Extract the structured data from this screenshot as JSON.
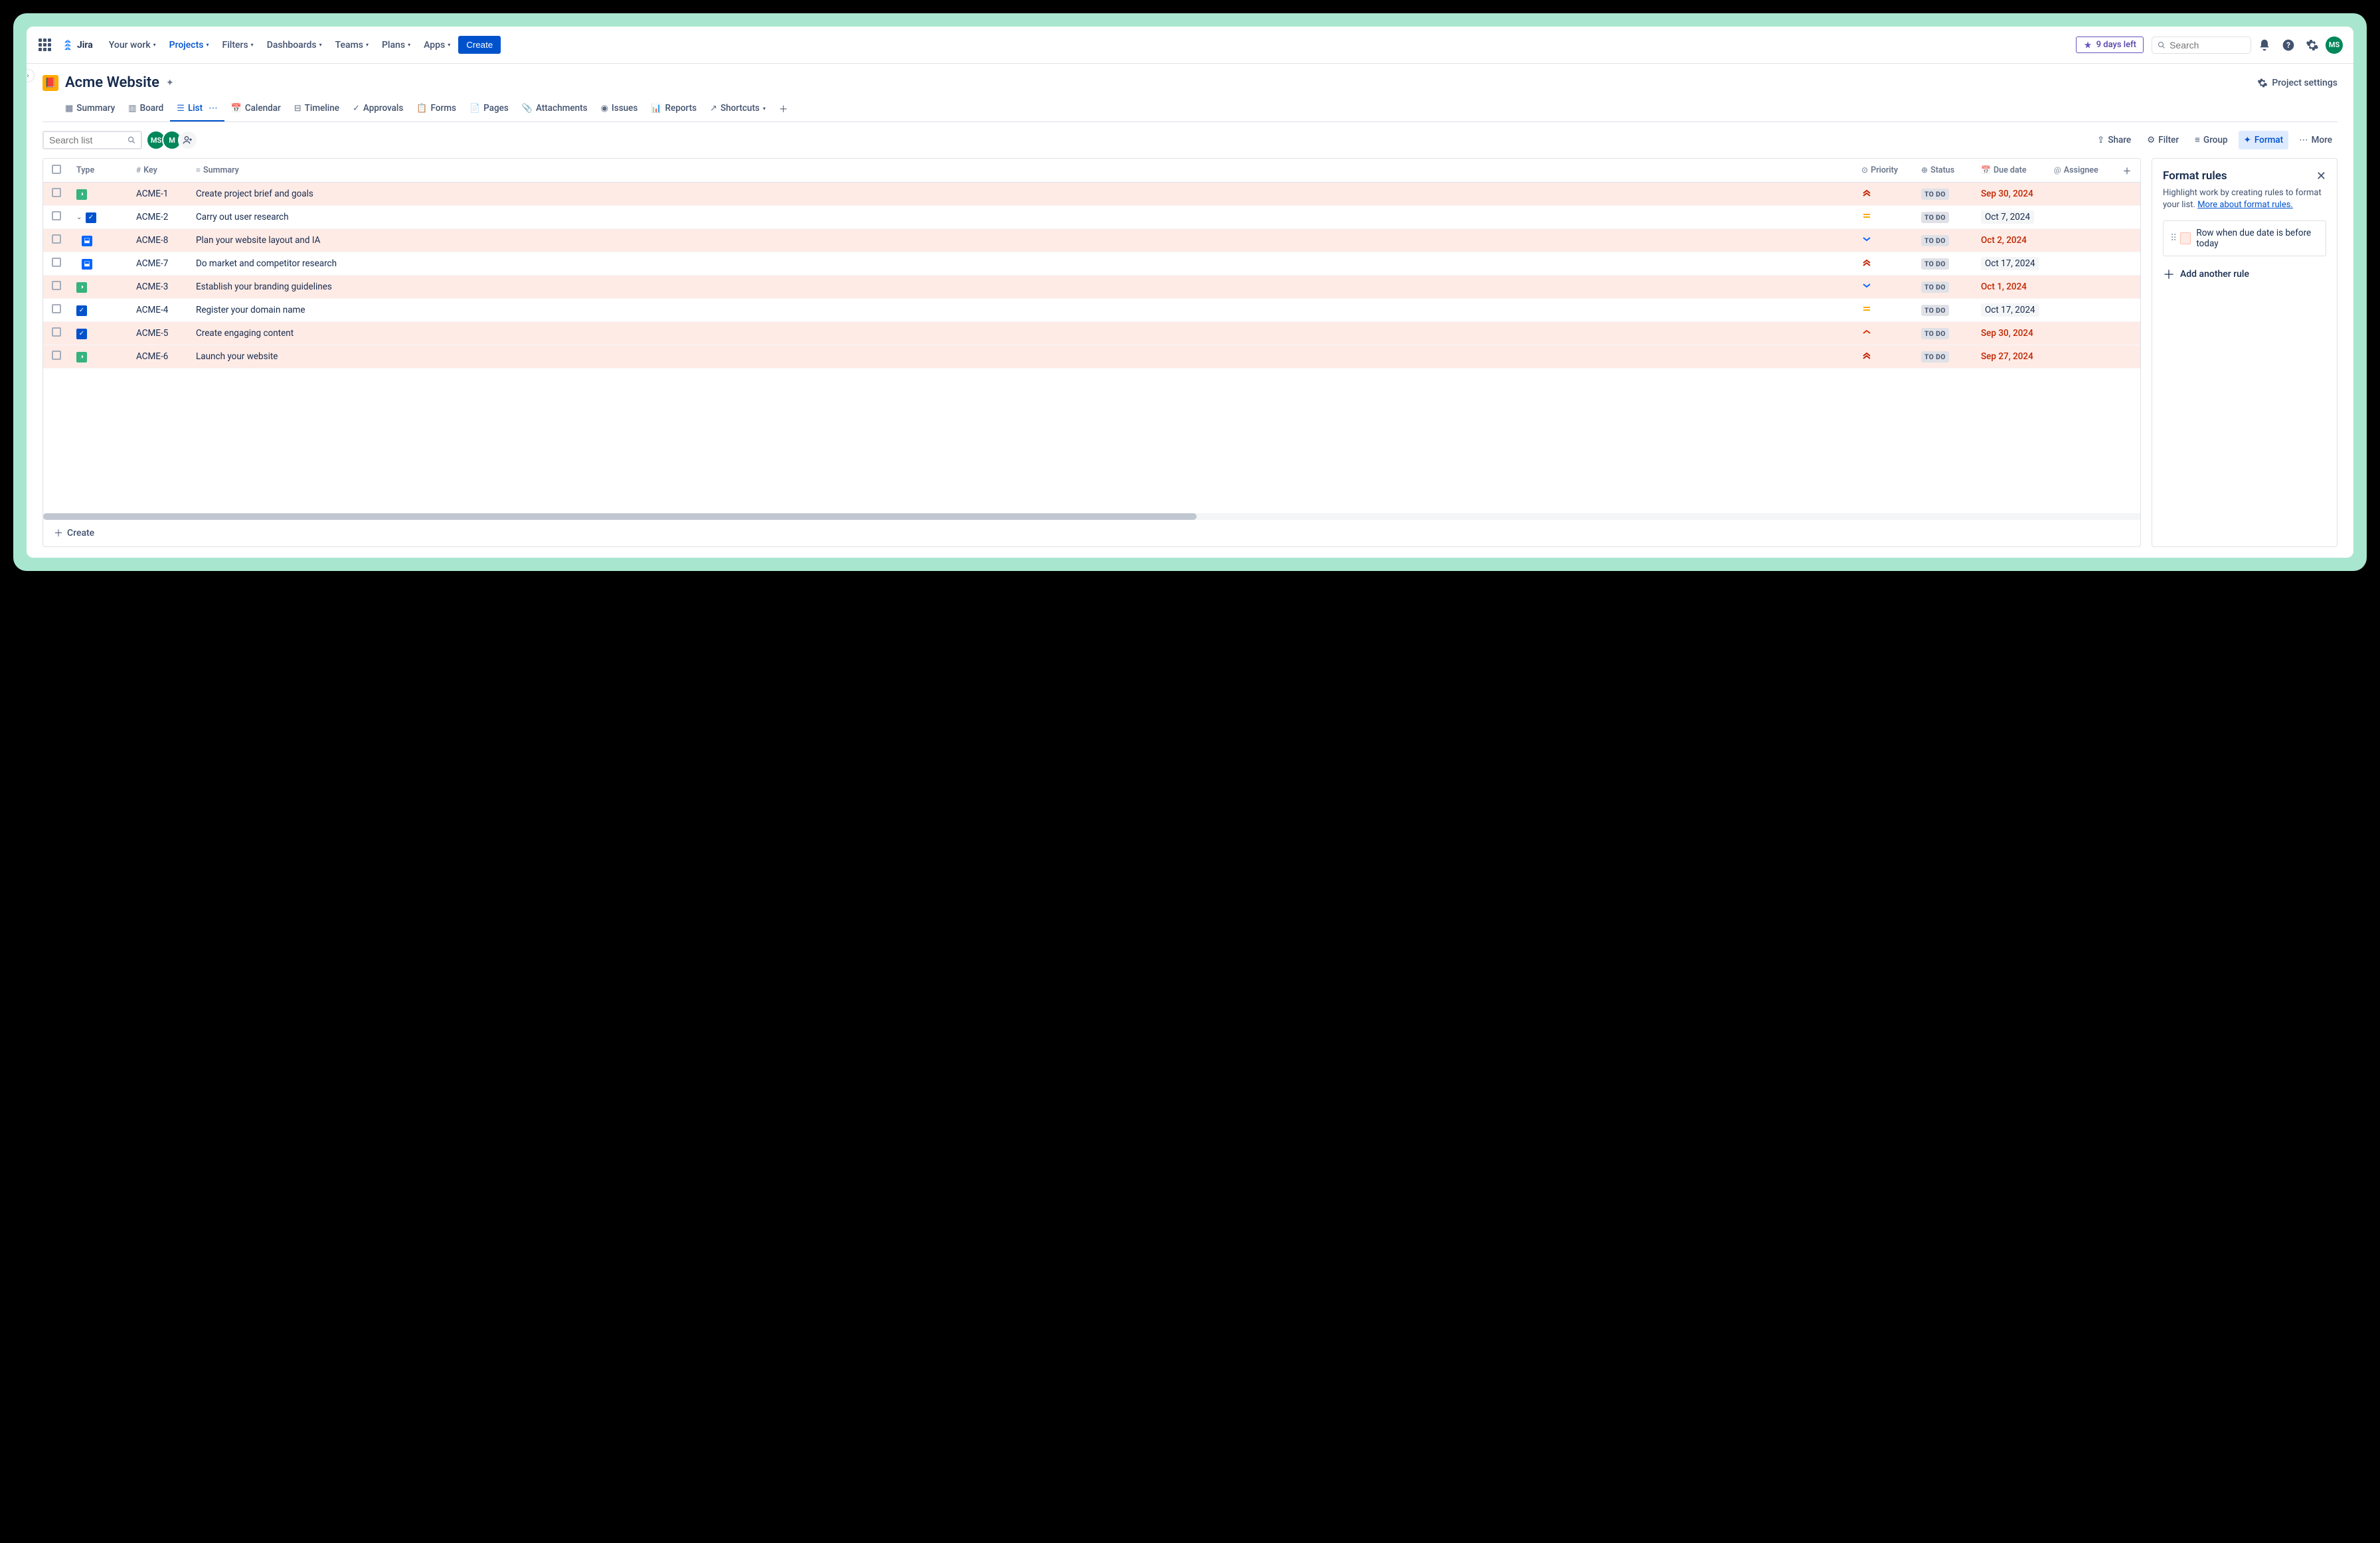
{
  "nav": {
    "product": "Jira",
    "items": [
      "Your work",
      "Projects",
      "Filters",
      "Dashboards",
      "Teams",
      "Plans",
      "Apps"
    ],
    "active_index": 1,
    "create": "Create",
    "trial": "9 days left",
    "search_placeholder": "Search",
    "avatar": "MS"
  },
  "project": {
    "title": "Acme Website",
    "settings": "Project settings"
  },
  "tabs": {
    "items": [
      "Summary",
      "Board",
      "List",
      "Calendar",
      "Timeline",
      "Approvals",
      "Forms",
      "Pages",
      "Attachments",
      "Issues",
      "Reports",
      "Shortcuts"
    ],
    "active_index": 2
  },
  "toolbar": {
    "search_placeholder": "Search list",
    "share": "Share",
    "filter": "Filter",
    "group": "Group",
    "format": "Format",
    "more": "More",
    "avatar1": "MS",
    "avatar2": "M"
  },
  "columns": {
    "type": "Type",
    "key": "Key",
    "summary": "Summary",
    "priority": "Priority",
    "status": "Status",
    "due": "Due date",
    "assignee": "Assignee"
  },
  "rows": [
    {
      "key": "ACME-1",
      "type": "story",
      "summary": "Create project brief and goals",
      "priority": "highest",
      "status": "TO DO",
      "due": "Sep 30, 2024",
      "overdue": true,
      "indent": 0,
      "expand": false
    },
    {
      "key": "ACME-2",
      "type": "task",
      "summary": "Carry out user research",
      "priority": "medium",
      "status": "TO DO",
      "due": "Oct 7, 2024",
      "overdue": false,
      "indent": 0,
      "expand": true
    },
    {
      "key": "ACME-8",
      "type": "sub",
      "summary": "Plan your website layout and IA",
      "priority": "low",
      "status": "TO DO",
      "due": "Oct 2, 2024",
      "overdue": true,
      "indent": 1,
      "expand": false
    },
    {
      "key": "ACME-7",
      "type": "sub",
      "summary": "Do market and competitor research",
      "priority": "highest",
      "status": "TO DO",
      "due": "Oct 17, 2024",
      "overdue": false,
      "indent": 1,
      "expand": false
    },
    {
      "key": "ACME-3",
      "type": "story",
      "summary": "Establish your branding guidelines",
      "priority": "low",
      "status": "TO DO",
      "due": "Oct 1, 2024",
      "overdue": true,
      "indent": 0,
      "expand": false
    },
    {
      "key": "ACME-4",
      "type": "task",
      "summary": "Register your domain name",
      "priority": "medium",
      "status": "TO DO",
      "due": "Oct 17, 2024",
      "overdue": false,
      "indent": 0,
      "expand": false
    },
    {
      "key": "ACME-5",
      "type": "task",
      "summary": "Create engaging content",
      "priority": "high",
      "status": "TO DO",
      "due": "Sep 30, 2024",
      "overdue": true,
      "indent": 0,
      "expand": false
    },
    {
      "key": "ACME-6",
      "type": "story",
      "summary": "Launch your website",
      "priority": "highest",
      "status": "TO DO",
      "due": "Sep 27, 2024",
      "overdue": true,
      "indent": 0,
      "expand": false
    }
  ],
  "create_label": "Create",
  "panel": {
    "title": "Format rules",
    "desc": "Highlight work by creating rules to format your list. ",
    "link": "More about format rules.",
    "rule": "Row when due date is before today",
    "add": "Add another rule"
  }
}
